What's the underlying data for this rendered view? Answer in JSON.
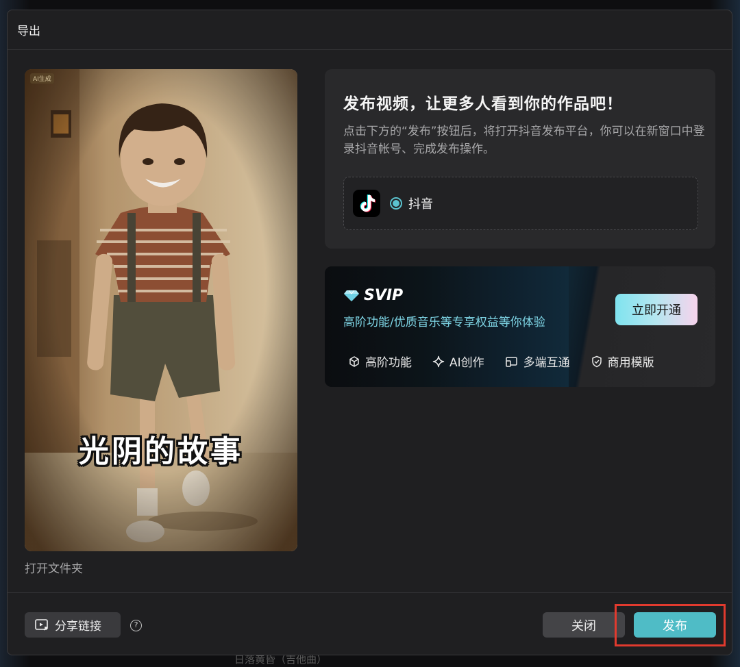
{
  "dialog": {
    "title": "导出"
  },
  "preview": {
    "badge": "AI生成",
    "caption": "光阴的故事",
    "open_folder": "打开文件夹"
  },
  "publish": {
    "title": "发布视频，让更多人看到你的作品吧！",
    "description": "点击下方的“发布”按钮后，将打开抖音发布平台，你可以在新窗口中登录抖音帐号、完成发布操作。",
    "platform": {
      "name": "抖音",
      "selected": true,
      "icon": "tiktok-icon"
    }
  },
  "svip": {
    "label": "SVIP",
    "subtitle": "高阶功能/优质音乐等专享权益等你体验",
    "cta": "立即开通",
    "features": [
      {
        "label": "高阶功能",
        "icon": "cube-icon"
      },
      {
        "label": "AI创作",
        "icon": "sparkle-icon"
      },
      {
        "label": "多端互通",
        "icon": "devices-icon"
      },
      {
        "label": "商用模版",
        "icon": "shield-check-icon"
      }
    ]
  },
  "footer": {
    "share_label": "分享链接",
    "help": "?",
    "close_label": "关闭",
    "publish_label": "发布"
  },
  "background": {
    "caption": "日落黄昏（吉他曲）"
  },
  "colors": {
    "accent": "#4fbcc6",
    "highlight": "#e13a2e",
    "svip_text": "#7fd6e6"
  }
}
